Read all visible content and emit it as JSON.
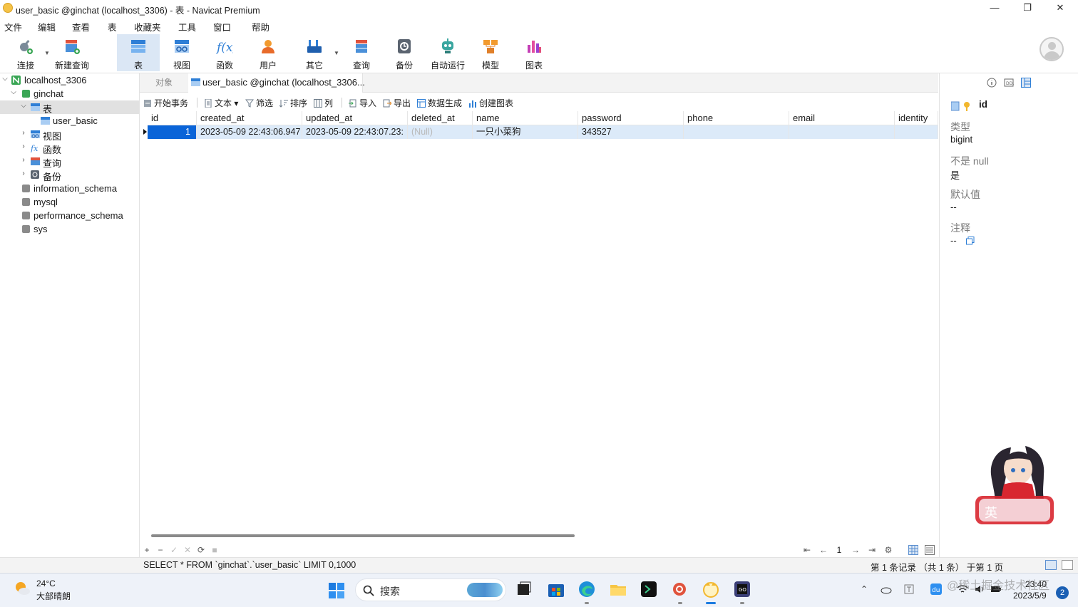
{
  "window": {
    "title": "user_basic @ginchat (localhost_3306) - 表 - Navicat Premium",
    "minimize": "—",
    "restore": "❐",
    "close": "✕"
  },
  "menu": [
    "文件",
    "编辑",
    "查看",
    "表",
    "收藏夹",
    "工具",
    "窗口",
    "帮助"
  ],
  "toolbar": {
    "items": [
      {
        "label": "连接",
        "icon": "connect-plug-icon"
      },
      {
        "label": "新建查询",
        "icon": "new-query-icon"
      },
      {
        "label": "表",
        "icon": "table-icon"
      },
      {
        "label": "视图",
        "icon": "view-icon"
      },
      {
        "label": "函数",
        "icon": "function-icon"
      },
      {
        "label": "用户",
        "icon": "user-icon"
      },
      {
        "label": "其它",
        "icon": "other-tools-icon"
      },
      {
        "label": "查询",
        "icon": "query-icon"
      },
      {
        "label": "备份",
        "icon": "backup-icon"
      },
      {
        "label": "自动运行",
        "icon": "robot-icon"
      },
      {
        "label": "模型",
        "icon": "model-icon"
      },
      {
        "label": "图表",
        "icon": "chart-icon"
      }
    ]
  },
  "tree": {
    "connection": "localhost_3306",
    "database": "ginchat",
    "tables_folder": "表",
    "table": "user_basic",
    "views": "视图",
    "functions": "函数",
    "queries": "查询",
    "backups": "备份",
    "other_dbs": [
      "information_schema",
      "mysql",
      "performance_schema",
      "sys"
    ]
  },
  "tabs": {
    "objects": "对象",
    "current": "user_basic @ginchat (localhost_3306..."
  },
  "datatoolbar": {
    "begin_transaction": "开始事务",
    "text": "文本",
    "filter": "筛选",
    "sort": "排序",
    "columns": "列",
    "import": "导入",
    "export": "导出",
    "data_generation": "数据生成",
    "create_chart": "创建图表"
  },
  "grid": {
    "columns": [
      "id",
      "created_at",
      "updated_at",
      "deleted_at",
      "name",
      "password",
      "phone",
      "email",
      "identity"
    ],
    "rows": [
      [
        "1",
        "2023-05-09 22:43:06.947",
        "2023-05-09 22:43:07.23:",
        "(Null)",
        "一只小菜狗",
        "343527",
        "",
        "",
        ""
      ]
    ]
  },
  "gridcontrols": {
    "add": "+",
    "delete": "−",
    "apply": "✓",
    "discard": "✕",
    "refresh": "⟳",
    "stop": "■",
    "first": "⇤",
    "prev": "←",
    "page": "1",
    "next": "→",
    "last": "⇥",
    "settings": "⚙"
  },
  "status": {
    "sql": "SELECT * FROM `ginchat`.`user_basic` LIMIT 0,1000",
    "records": "第 1 条记录 （共 1 条） 于第 1 页"
  },
  "infopanel": {
    "field_name": "id",
    "type_label": "类型",
    "type_value": "bigint",
    "notnull_label": "不是 null",
    "notnull_value": "是",
    "default_label": "默认值",
    "default_value": "--",
    "comment_label": "注释",
    "comment_value": "--",
    "mascot_ime_char": "英"
  },
  "taskbar": {
    "temperature": "24°C",
    "weather": "大部晴朗",
    "search_placeholder": "搜索",
    "time": "23:40",
    "date": "2023/5/9",
    "notifications": "2",
    "watermark": "@稀土掘金技术社区"
  },
  "colors": {
    "accent": "#0a64d8",
    "selected_row": "#dceaf9",
    "active_tool": "#dbe7f5"
  }
}
